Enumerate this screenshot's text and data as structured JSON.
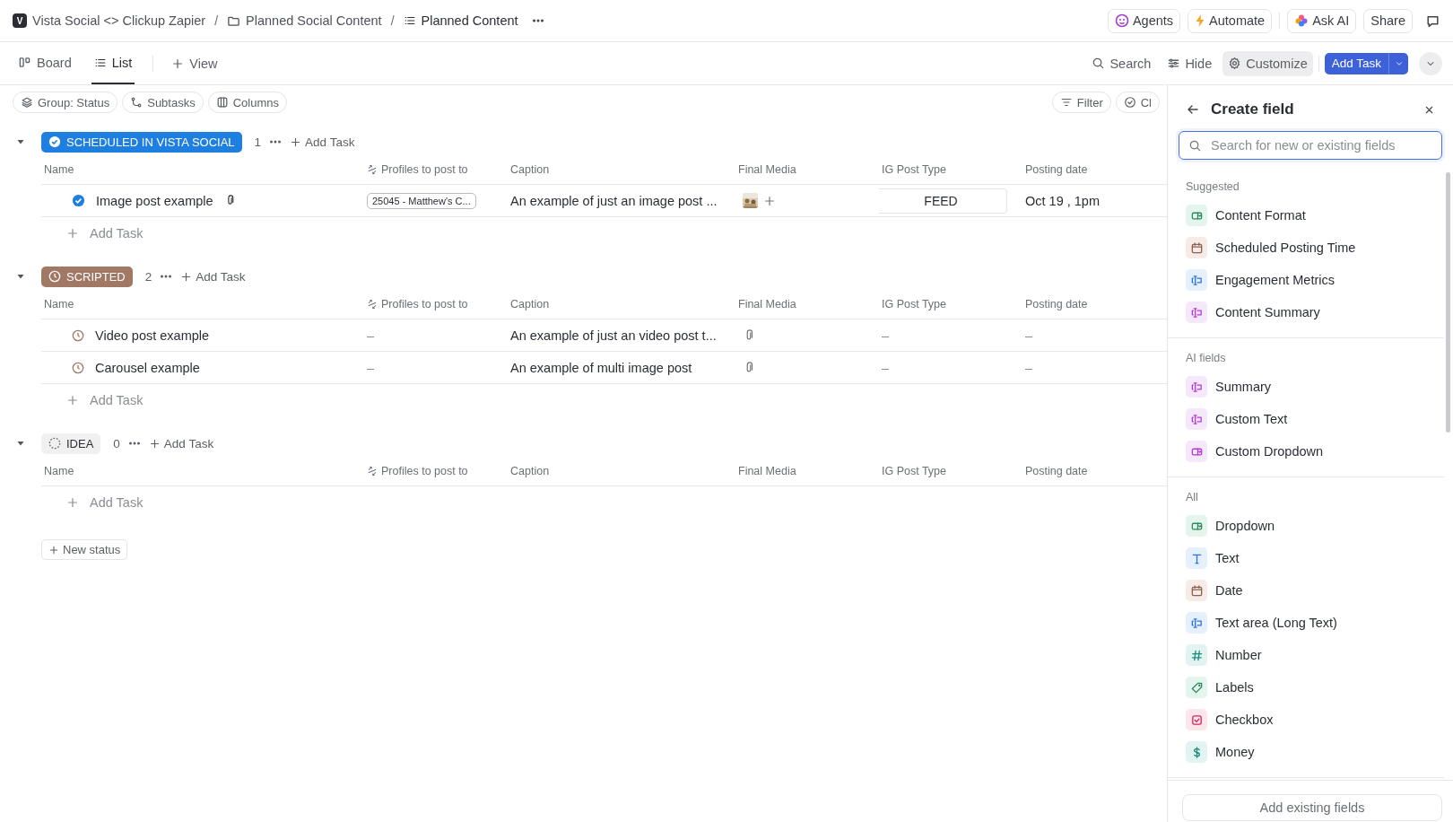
{
  "breadcrumb": [
    {
      "kind": "workspace",
      "label": "Vista Social <> Clickup Zapier",
      "badge": "V"
    },
    {
      "kind": "folder",
      "label": "Planned Social Content"
    },
    {
      "kind": "list",
      "label": "Planned Content"
    }
  ],
  "breadcrumb_separator": "/",
  "header_actions": [
    {
      "kind": "agents",
      "label": "Agents"
    },
    {
      "kind": "automate",
      "label": "Automate"
    },
    {
      "kind": "ai",
      "label": "Ask AI"
    },
    {
      "kind": "plain",
      "label": "Share"
    }
  ],
  "view_tabs": [
    {
      "kind": "board",
      "label": "Board",
      "selected": false
    },
    {
      "kind": "list",
      "label": "List",
      "selected": true
    }
  ],
  "add_view": "View",
  "toolbar": [
    {
      "kind": "search",
      "label": "Search",
      "selected": false
    },
    {
      "kind": "hide",
      "label": "Hide",
      "selected": false
    },
    {
      "kind": "customize",
      "label": "Customize",
      "selected": true
    }
  ],
  "add_task_button": "Add Task",
  "filter_chips": [
    {
      "kind": "group",
      "label": "Group: Status"
    },
    {
      "kind": "subtasks",
      "label": "Subtasks"
    },
    {
      "kind": "columns",
      "label": "Columns"
    }
  ],
  "right_chips": [
    {
      "kind": "filter",
      "label": "Filter"
    },
    {
      "kind": "closed",
      "label": "Cl"
    }
  ],
  "groups": [
    {
      "status": "SCHEDULED IN VISTA SOCIAL",
      "kind": "done",
      "color": "#1f7fe0",
      "count": "1",
      "add_label": "Add Task",
      "columns": [
        "Name",
        "Profiles to post to",
        "Caption",
        "Final Media",
        "IG Post Type",
        "Posting date"
      ],
      "add_row": "Add Task",
      "tasks": [
        {
          "name": "Image post example",
          "has_attachment": true,
          "profile": "25045 - Matthew's C...",
          "caption": "An example of just an image post ...",
          "media": {
            "kind": "thumbnail"
          },
          "ig_post_type": "FEED",
          "posting_date": "Oct 19 , 1pm"
        }
      ]
    },
    {
      "status": "SCRIPTED",
      "kind": "progress",
      "color": "#a07864",
      "count": "2",
      "add_label": "Add Task",
      "columns": [
        "Name",
        "Profiles to post to",
        "Caption",
        "Final Media",
        "IG Post Type",
        "Posting date"
      ],
      "add_row": "Add Task",
      "tasks": [
        {
          "name": "Video post example",
          "has_attachment": false,
          "profile": "–",
          "caption": "An example of just an video post t...",
          "media": {
            "kind": "attachment"
          },
          "ig_post_type": "–",
          "posting_date": "–"
        },
        {
          "name": "Carousel example",
          "has_attachment": false,
          "profile": "–",
          "caption": "An example of multi image post",
          "media": {
            "kind": "attachment"
          },
          "ig_post_type": "–",
          "posting_date": "–"
        }
      ]
    },
    {
      "status": "IDEA",
      "kind": "todo",
      "color": "#f0f0f0",
      "count": "0",
      "add_label": "Add Task",
      "columns": [
        "Name",
        "Profiles to post to",
        "Caption",
        "Final Media",
        "IG Post Type",
        "Posting date"
      ],
      "add_row": "Add Task"
    }
  ],
  "new_status": "New status",
  "panel": {
    "title": "Create field",
    "search_placeholder": "Search for new or existing fields",
    "sections": [
      {
        "title": "Suggested",
        "items": [
          {
            "label": "Content Format",
            "kind": "dropdown"
          },
          {
            "label": "Scheduled Posting Time",
            "kind": "date"
          },
          {
            "label": "Engagement Metrics",
            "kind": "textarea"
          },
          {
            "label": "Content Summary",
            "kind": "ai_text"
          }
        ]
      },
      {
        "title": "AI fields",
        "items": [
          {
            "label": "Summary",
            "kind": "ai_text"
          },
          {
            "label": "Custom Text",
            "kind": "ai_text"
          },
          {
            "label": "Custom Dropdown",
            "kind": "ai_dropdown"
          }
        ]
      },
      {
        "title": "All",
        "items": [
          {
            "label": "Dropdown",
            "kind": "dropdown"
          },
          {
            "label": "Text",
            "kind": "text"
          },
          {
            "label": "Date",
            "kind": "date"
          },
          {
            "label": "Text area (Long Text)",
            "kind": "textarea"
          },
          {
            "label": "Number",
            "kind": "number"
          },
          {
            "label": "Labels",
            "kind": "labels"
          },
          {
            "label": "Checkbox",
            "kind": "checkbox"
          },
          {
            "label": "Money",
            "kind": "money"
          }
        ]
      }
    ],
    "footer_button": "Add existing fields"
  }
}
